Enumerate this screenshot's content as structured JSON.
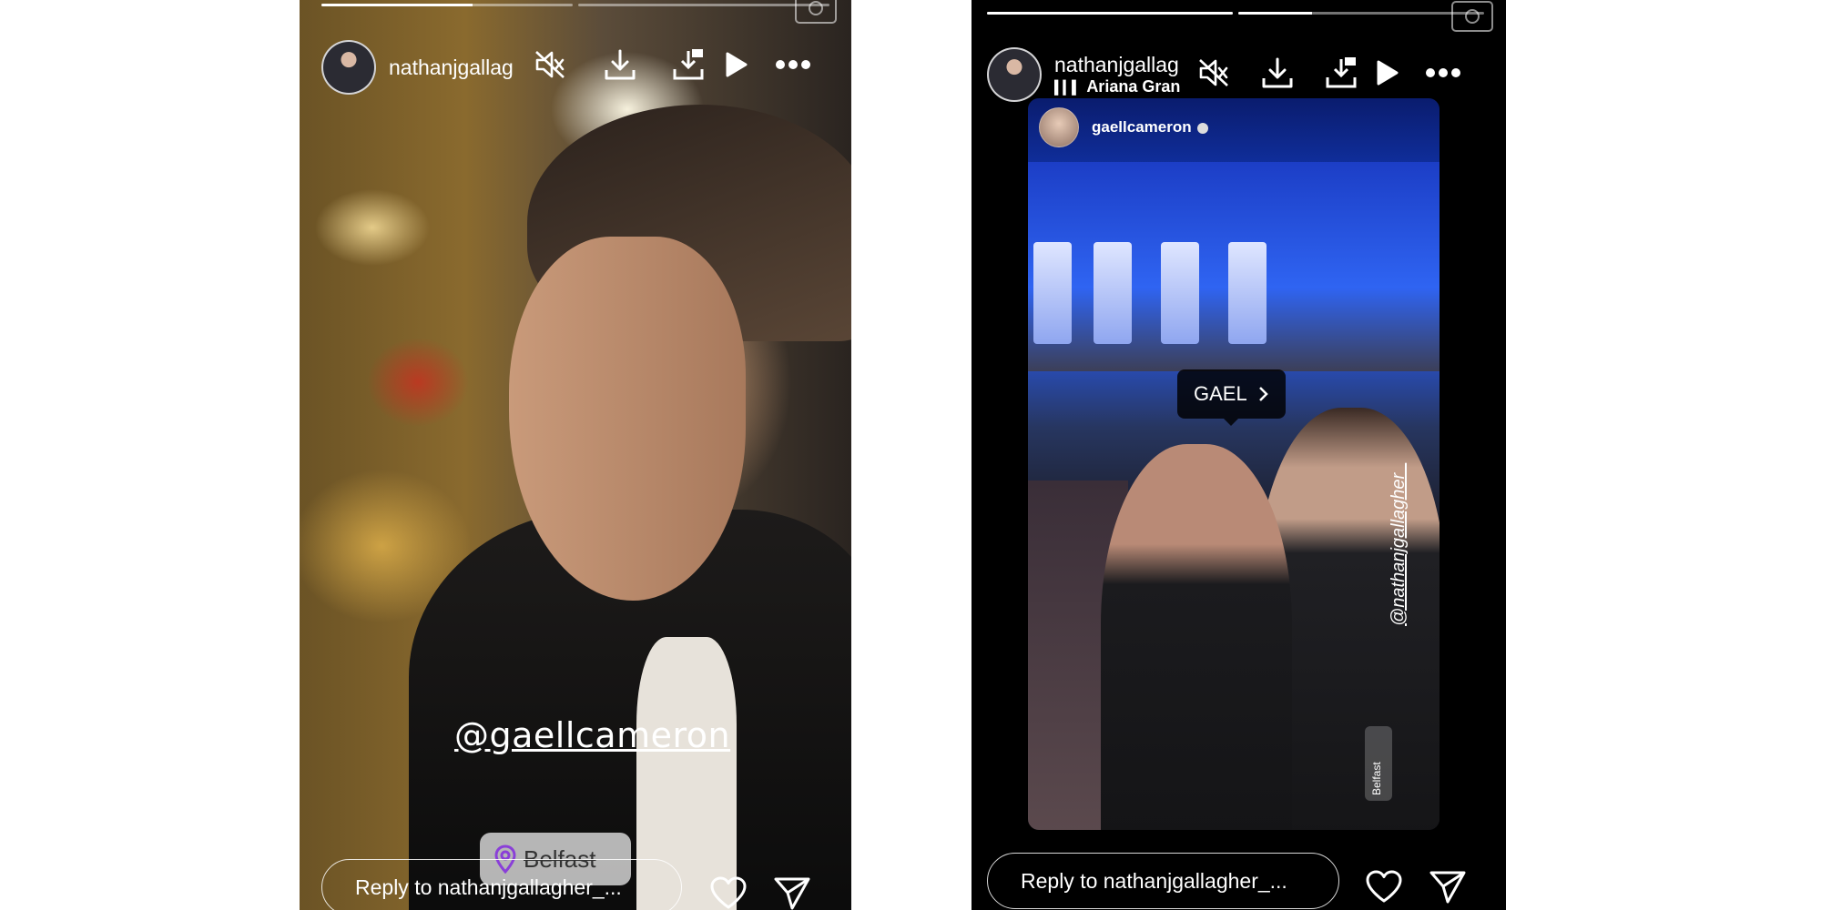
{
  "left_story": {
    "username": "nathanjgallagher_",
    "progress": [
      0.6,
      0.0
    ],
    "mention_sticker": "@gaellcameron",
    "location_sticker": "Belfast",
    "reply_placeholder": "Reply to nathanjgallagher_..."
  },
  "right_story": {
    "username": "nathanjgallagher_",
    "song": "Ariana Grande",
    "progress": [
      1.0,
      0.3
    ],
    "shared_post_user": "gaellcameron",
    "tag_label": "GAEL",
    "vertical_mention": "@nathanjgallagher_",
    "vertical_location": "Belfast",
    "reply_placeholder": "Reply to nathanjgallagher_..."
  },
  "icons": {
    "mute": "speaker-muted-icon",
    "download": "download-icon",
    "save": "save-icon",
    "play": "play-icon",
    "more": "more-icon",
    "like": "heart-icon",
    "share": "send-icon",
    "camera": "camera-icon",
    "location": "location-pin-icon"
  }
}
